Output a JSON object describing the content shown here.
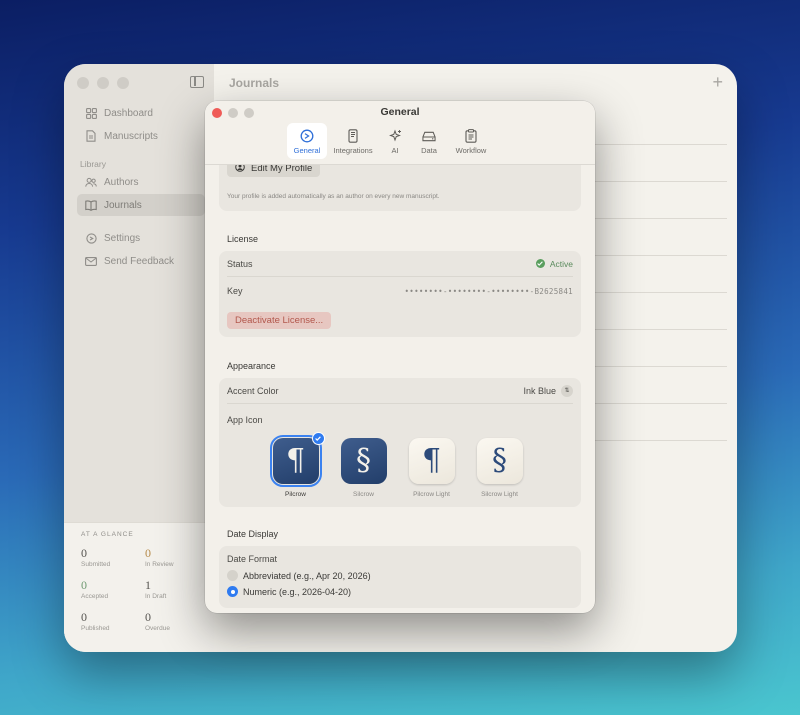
{
  "main_window": {
    "title": "Journals",
    "plus_icon": "plus-icon",
    "sidebar": {
      "items": [
        {
          "label": "Dashboard",
          "icon": "grid-icon"
        },
        {
          "label": "Manuscripts",
          "icon": "document-icon"
        }
      ],
      "library_label": "Library",
      "library_items": [
        {
          "label": "Authors",
          "icon": "people-icon"
        },
        {
          "label": "Journals",
          "icon": "book-icon",
          "active": true
        }
      ],
      "footer_items": [
        {
          "label": "Settings",
          "icon": "gear-icon"
        },
        {
          "label": "Send Feedback",
          "icon": "envelope-icon"
        }
      ]
    },
    "glance": {
      "title": "AT A GLANCE",
      "stats": [
        {
          "value": "0",
          "label": "Submitted"
        },
        {
          "value": "0",
          "label": "In Review"
        },
        {
          "value": "0",
          "label": "Accepted"
        },
        {
          "value": "1",
          "label": "In Draft"
        },
        {
          "value": "0",
          "label": "Published"
        },
        {
          "value": "0",
          "label": "Overdue"
        }
      ]
    }
  },
  "dialog": {
    "title": "General",
    "tabs": [
      {
        "label": "General",
        "icon": "gear-icon",
        "active": true
      },
      {
        "label": "Integrations",
        "icon": "phone-icon"
      },
      {
        "label": "AI",
        "icon": "sparkles-icon"
      },
      {
        "label": "Data",
        "icon": "drive-icon"
      },
      {
        "label": "Workflow",
        "icon": "clipboard-icon"
      }
    ],
    "profile": {
      "edit_button": "Edit My Profile",
      "hint": "Your profile is added automatically as an author on every new manuscript."
    },
    "license": {
      "heading": "License",
      "status_label": "Status",
      "status_value": "Active",
      "key_label": "Key",
      "key_value": "••••••••-••••••••-••••••••-B2625841",
      "deactivate_button": "Deactivate License..."
    },
    "appearance": {
      "heading": "Appearance",
      "accent_label": "Accent Color",
      "accent_value": "Ink Blue",
      "app_icon_label": "App Icon",
      "icons": [
        {
          "label": "Pilcrow",
          "glyph": "¶",
          "style": "dark",
          "selected": true
        },
        {
          "label": "Silcrow",
          "glyph": "§",
          "style": "dark",
          "selected": false
        },
        {
          "label": "Pilcrow Light",
          "glyph": "¶",
          "style": "light",
          "selected": false
        },
        {
          "label": "Silcrow Light",
          "glyph": "§",
          "style": "light",
          "selected": false
        }
      ]
    },
    "date_display": {
      "heading": "Date Display",
      "format_label": "Date Format",
      "options": [
        {
          "label": "Abbreviated (e.g., Apr 20, 2026)",
          "selected": false
        },
        {
          "label": "Numeric (e.g., 2026-04-20)",
          "selected": true
        }
      ]
    }
  },
  "colors": {
    "accent": "#2f7bf0",
    "active_green": "#5a9e5e",
    "danger": "#b2574c"
  }
}
